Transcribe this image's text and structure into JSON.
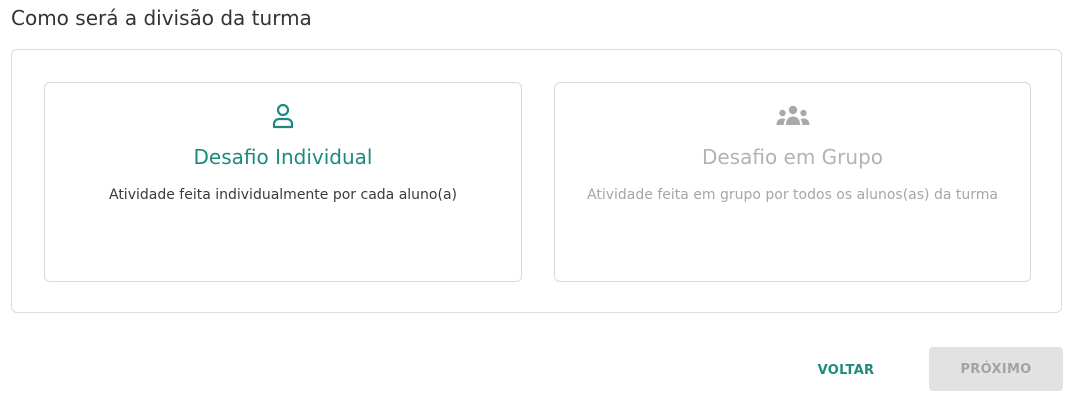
{
  "header": {
    "title": "Como será a divisão da turma"
  },
  "options": [
    {
      "title": "Desafio Individual",
      "description": "Atividade feita individualmente por cada aluno(a)",
      "icon": "person-icon",
      "selected": true
    },
    {
      "title": "Desafio em Grupo",
      "description": "Atividade feita em grupo por todos os alunos(as) da turma",
      "icon": "group-icon",
      "selected": false
    }
  ],
  "actions": {
    "back_label": "VOLTAR",
    "next_label": "PRÓXIMO",
    "next_enabled": false
  },
  "colors": {
    "accent": "#1e8a7f",
    "disabled_text": "#b3b3b3",
    "disabled_button_bg": "#e2e2e2"
  }
}
